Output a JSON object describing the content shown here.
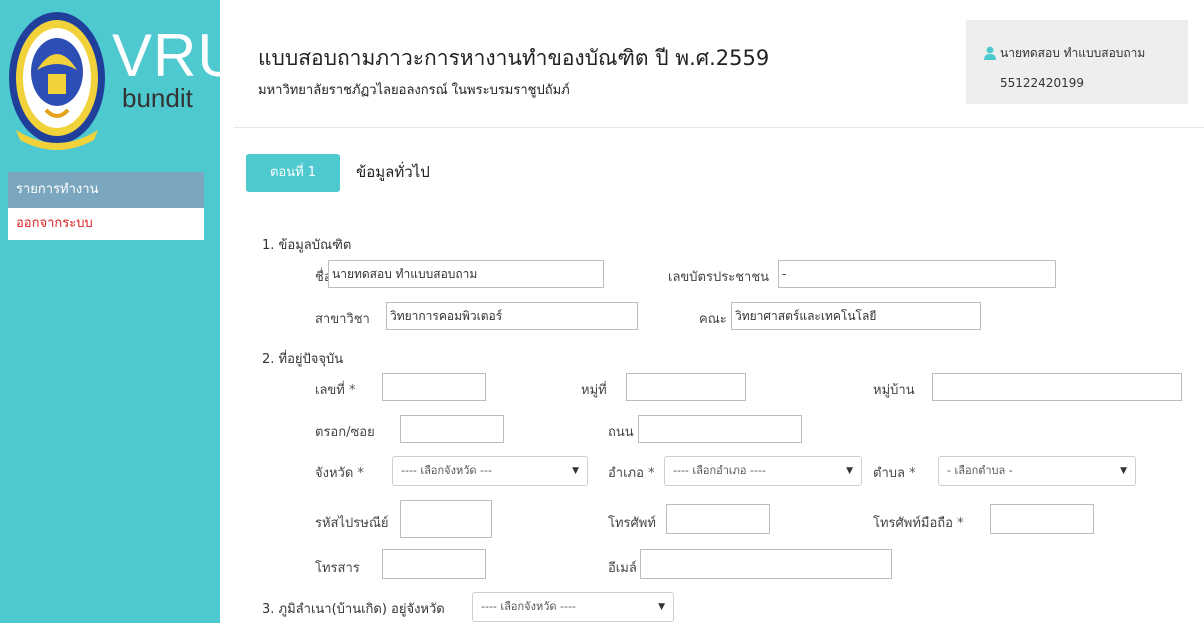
{
  "brand": {
    "name": "VRU",
    "sub": "bundit",
    "seal_text": "มหาวิทยาลัยราชภัฏวไลยอลงกรณ์"
  },
  "sidebar": {
    "menu_header": "รายการทำงาน",
    "logout": "ออกจากระบบ"
  },
  "header": {
    "title": "แบบสอบถามภาวะการหางานทำของบัณฑิต ปี พ.ศ.2559",
    "subtitle": "มหาวิทยาลัยราชภัฏวไลยอลงกรณ์ ในพระบรมราชูปถัมภ์"
  },
  "user": {
    "name": "นายทดสอบ ทำแบบสอบถาม",
    "id": "55122420199"
  },
  "section": {
    "step_label": "ตอนที่ 1",
    "title": "ข้อมูลทั่วไป"
  },
  "form": {
    "q1": {
      "label": "1. ข้อมูลบัณฑิต",
      "name_label": "ชื่อ",
      "name_value": "นายทดสอบ ทำแบบสอบถาม",
      "id_card_label": "เลขบัตรประชาชน",
      "id_card_value": "-",
      "major_label": "สาขาวิชา",
      "major_value": "วิทยาการคอมพิวเตอร์",
      "faculty_label": "คณะ",
      "faculty_value": "วิทยาศาสตร์และเทคโนโลยี"
    },
    "q2": {
      "label": "2. ที่อยู่ปัจจุบัน",
      "house_no_label": "เลขที่",
      "moo_label": "หมู่ที่",
      "village_label": "หมู่บ้าน",
      "alley_label": "ตรอก/ซอย",
      "road_label": "ถนน",
      "province_label": "จังหวัด",
      "province_value": "---- เลือกจังหวัด ---",
      "district_label": "อำเภอ",
      "district_value": "---- เลือกอำเภอ ----",
      "subdistrict_label": "ตำบล",
      "subdistrict_value": "- เลือกตำบล -",
      "postcode_label": "รหัสไปรษณีย์",
      "phone_label": "โทรศัพท์",
      "mobile_label": "โทรศัพท์มือถือ",
      "fax_label": "โทรสาร",
      "email_label": "อีเมล์"
    },
    "q3": {
      "label": "3. ภูมิลำเนา(บ้านเกิด) อยู่จังหวัด",
      "province_value": "---- เลือกจังหวัด ----"
    },
    "required_mark": "*"
  },
  "colors": {
    "accent": "#4ec9cf",
    "menu_header_bg": "#7ba6bf",
    "logout_text": "#e02020"
  }
}
